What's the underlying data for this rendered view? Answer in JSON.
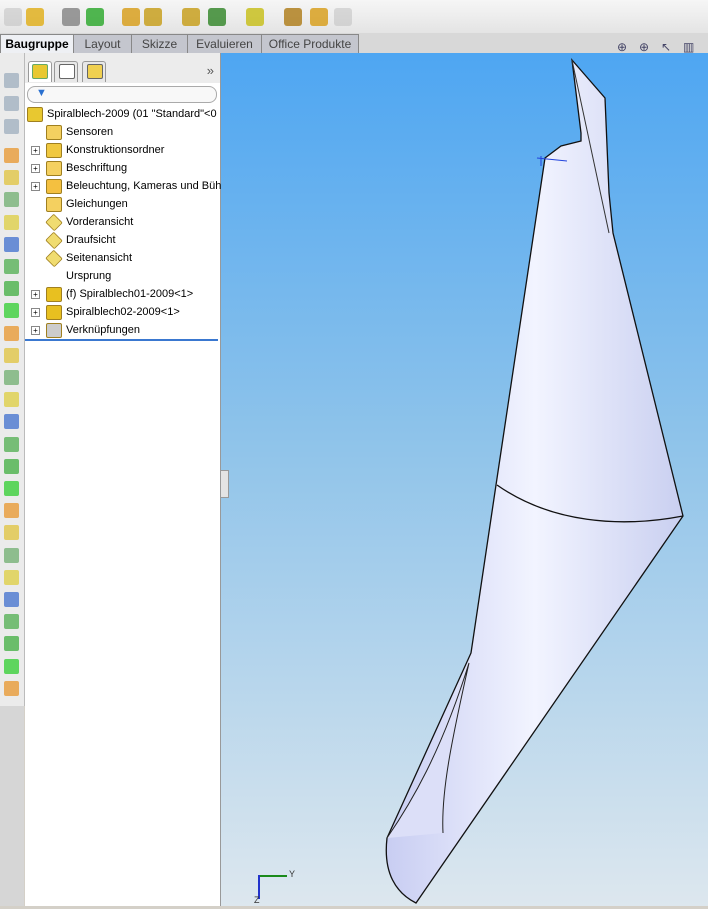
{
  "tabs": [
    "Baugruppe",
    "Layout",
    "Skizze",
    "Evaluieren",
    "Office Produkte"
  ],
  "panel": {
    "expand": "»",
    "tree": [
      {
        "label": "Spiralblech-2009  (01 \"Standard\"<0",
        "icon": "assembly-icon",
        "expandable": false,
        "root": true
      },
      {
        "label": "Sensoren",
        "icon": "sensor-folder-icon",
        "expandable": false
      },
      {
        "label": "Konstruktionsordner",
        "icon": "design-binder-icon",
        "expandable": true
      },
      {
        "label": "Beschriftung",
        "icon": "annotations-icon",
        "expandable": true
      },
      {
        "label": "Beleuchtung, Kameras und Bühr",
        "icon": "lights-icon",
        "expandable": true
      },
      {
        "label": "Gleichungen",
        "icon": "equations-icon",
        "expandable": false
      },
      {
        "label": "Vorderansicht",
        "icon": "plane-icon",
        "expandable": false
      },
      {
        "label": "Draufsicht",
        "icon": "plane-icon",
        "expandable": false
      },
      {
        "label": "Seitenansicht",
        "icon": "plane-icon",
        "expandable": false
      },
      {
        "label": "Ursprung",
        "icon": "origin-icon",
        "expandable": false
      },
      {
        "label": "(f) Spiralblech01-2009<1>",
        "icon": "part-icon",
        "expandable": true
      },
      {
        "label": "Spiralblech02-2009<1>",
        "icon": "part-icon",
        "expandable": true
      },
      {
        "label": "Verknüpfungen",
        "icon": "mates-icon",
        "expandable": true
      }
    ]
  },
  "triad": {
    "y": "Y",
    "z": "Z"
  },
  "colors": {
    "accent": "#3a78d0"
  }
}
